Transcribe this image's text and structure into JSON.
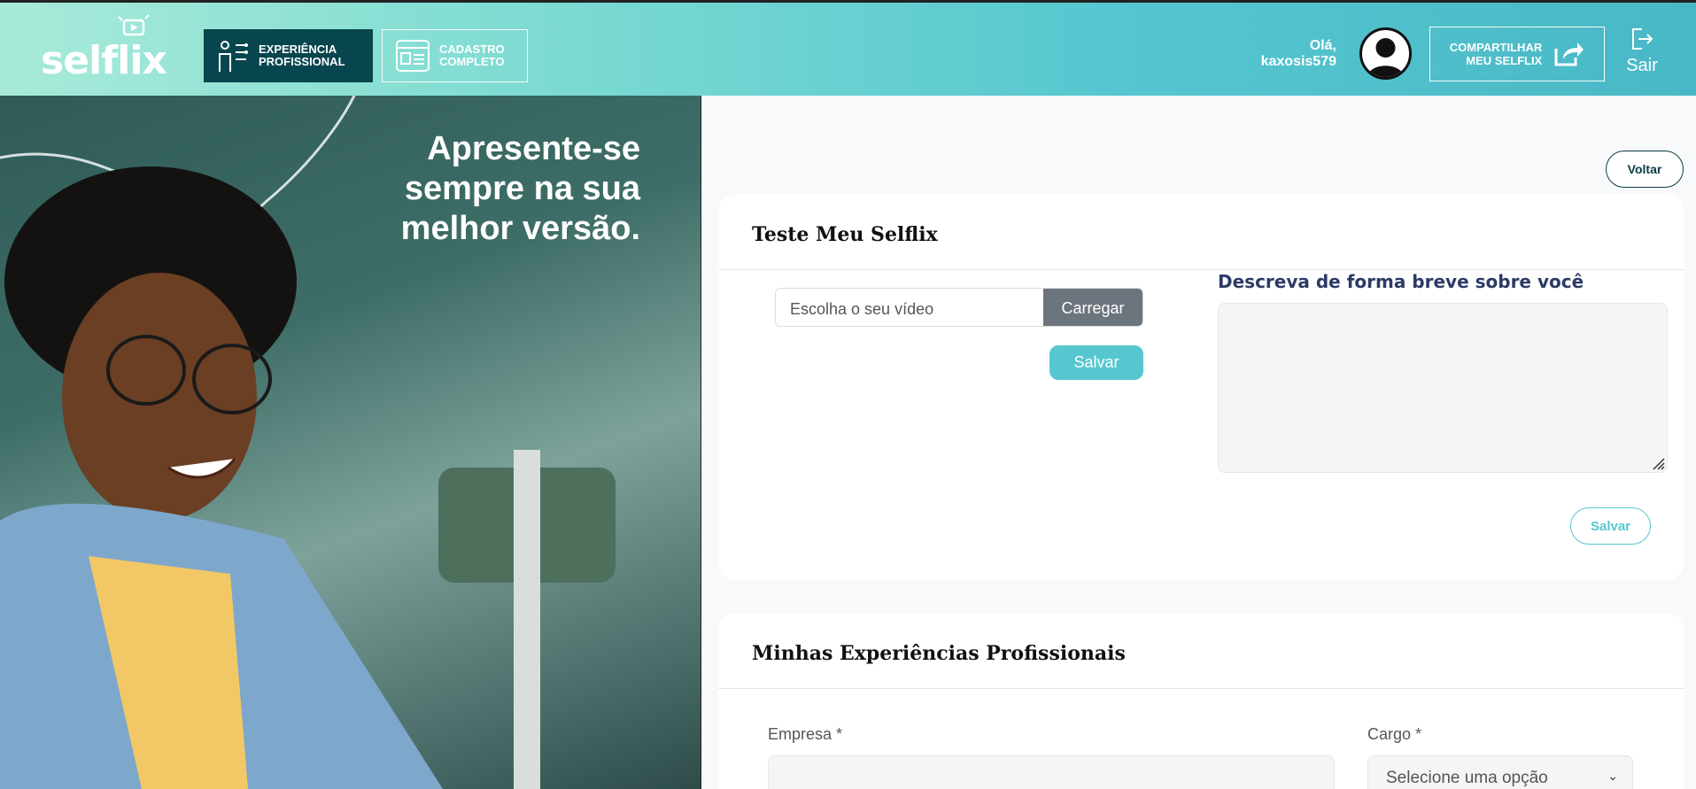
{
  "brand": {
    "logo_text": "selflix"
  },
  "nav": {
    "experience_line1": "EXPERIÊNCIA",
    "experience_line2": "PROFISSIONAL",
    "register_line1": "CADASTRO",
    "register_line2": "COMPLETO"
  },
  "user": {
    "greeting": "Olá,",
    "username": "kaxosis579"
  },
  "share": {
    "line1": "COMPARTILHAR",
    "line2": "MEU SELFLIX"
  },
  "logout": {
    "label": "Sair"
  },
  "hero": {
    "line1": "Apresente-se",
    "line2": "sempre na sua",
    "line3": "melhor versão."
  },
  "back_button": "Voltar",
  "test_card": {
    "title": "Teste Meu Selflix",
    "file_placeholder": "Escolha o seu vídeo",
    "upload_button": "Carregar",
    "save_video_button": "Salvar",
    "about_label": "Descreva de forma breve sobre você",
    "about_value": "",
    "save_about_button": "Salvar"
  },
  "experience_card": {
    "title": "Minhas Experiências Profissionais",
    "company_label": "Empresa *",
    "company_value": "",
    "role_label": "Cargo *",
    "role_selected": "Selecione uma opção"
  },
  "colors": {
    "accent": "#56c7d0",
    "nav_dark": "#08464f",
    "title_navy": "#2c3a66"
  }
}
